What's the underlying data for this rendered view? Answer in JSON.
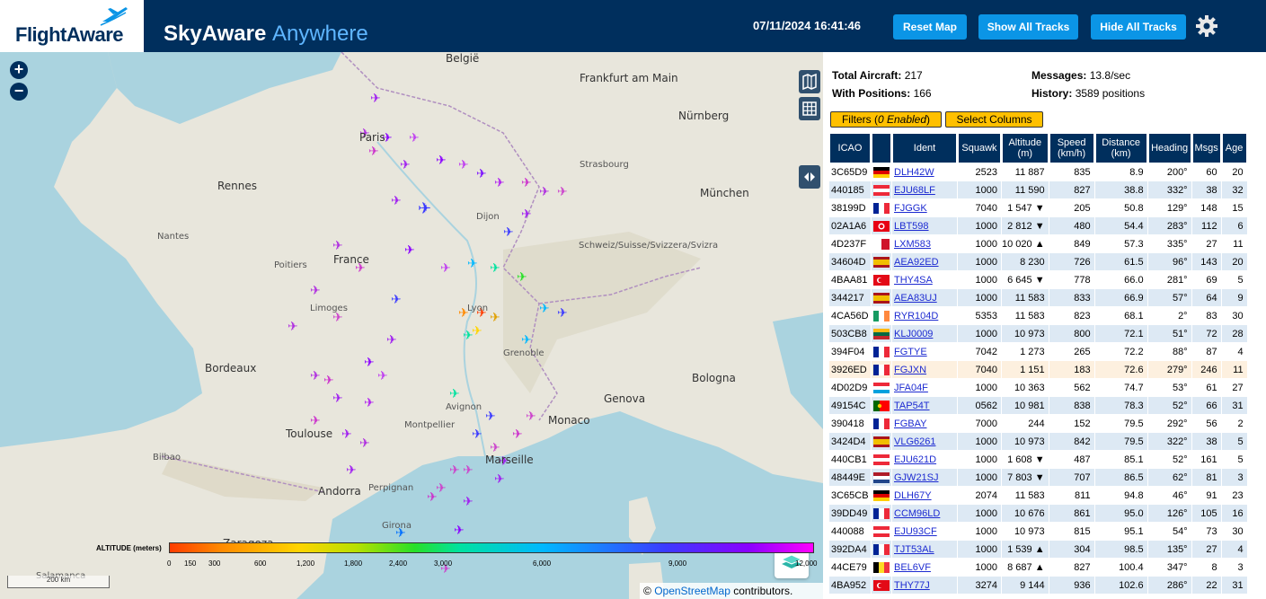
{
  "header": {
    "logo": "FlightAware",
    "brand_main": "SkyAware",
    "brand_accent": "Anywhere",
    "datetime": "07/11/2024 16:41:46",
    "reset_map": "Reset Map",
    "show_all_tracks": "Show All Tracks",
    "hide_all_tracks": "Hide All Tracks"
  },
  "map": {
    "zoom_in": "+",
    "zoom_out": "−",
    "labels": {
      "belgien": "België",
      "frankfurt": "Frankfurt am Main",
      "nurnberg": "Nürnberg",
      "paris": "Paris",
      "rennes": "Rennes",
      "france": "France",
      "bordeaux": "Bordeaux",
      "toulouse": "Toulouse",
      "andorra": "Andorra",
      "zaragoza": "Zaragoza",
      "munchen": "München",
      "genova": "Genova",
      "bologna": "Bologna",
      "marseille": "Marseille",
      "monaco": "Monaco",
      "grenoble": "Grenoble",
      "schweiz": "Schweiz/Suisse/Svizzera/Svizra",
      "strasbourg": "Strasbourg",
      "dijon": "Dijon",
      "lyon": "Lyon",
      "montpellier": "Montpellier",
      "poitiers": "Poitiers",
      "limoges": "Limoges",
      "nantes": "Nantes",
      "bilbao": "Bilbao",
      "perpignan": "Perpignan",
      "salamanca": "Salamanca",
      "avignon": "Avignon",
      "girona": "Girona"
    },
    "legend_title": "ALTITUDE (meters)",
    "legend_ticks": [
      "0",
      "150",
      "300",
      "600",
      "1,200",
      "1,800",
      "2,400",
      "3,000",
      "6,000",
      "9,000",
      "12,000"
    ],
    "scale": "200 km",
    "copyright_prefix": "©",
    "copyright_link": "OpenStreetMap",
    "copyright_suffix": "contributors."
  },
  "stats": {
    "total_label": "Total Aircraft:",
    "total_value": "217",
    "positions_label": "With Positions:",
    "positions_value": "166",
    "messages_label": "Messages:",
    "messages_value": "13.8/sec",
    "history_label": "History:",
    "history_value": "3589 positions"
  },
  "filters": {
    "filters_prefix": "Filters (",
    "filters_enabled": "0 Enabled",
    "filters_suffix": ")",
    "select_columns": "Select Columns"
  },
  "table": {
    "headers": [
      "ICAO",
      "",
      "Ident",
      "Squawk",
      "Altitude (m)",
      "Speed (km/h)",
      "Distance (km)",
      "Heading",
      "Msgs",
      "Age"
    ],
    "rows": [
      {
        "icao": "3C65D9",
        "flag": "de",
        "ident": "DLH42W",
        "squawk": "2523",
        "alt": "11 887",
        "speed": "835",
        "dist": "8.9",
        "heading": "200°",
        "msgs": "60",
        "age": "20"
      },
      {
        "icao": "440185",
        "flag": "at",
        "ident": "EJU68LF",
        "squawk": "1000",
        "alt": "11 590",
        "speed": "827",
        "dist": "38.8",
        "heading": "332°",
        "msgs": "38",
        "age": "32"
      },
      {
        "icao": "38199D",
        "flag": "fr",
        "ident": "FJGGK",
        "squawk": "7040",
        "alt": "1 547 ▼",
        "speed": "205",
        "dist": "50.8",
        "heading": "129°",
        "msgs": "148",
        "age": "15"
      },
      {
        "icao": "02A1A6",
        "flag": "tn",
        "ident": "LBT598",
        "squawk": "1000",
        "alt": "2 812 ▼",
        "speed": "480",
        "dist": "54.4",
        "heading": "283°",
        "msgs": "112",
        "age": "6"
      },
      {
        "icao": "4D237F",
        "flag": "mt",
        "ident": "LXM583",
        "squawk": "1000",
        "alt": "10 020 ▲",
        "speed": "849",
        "dist": "57.3",
        "heading": "335°",
        "msgs": "27",
        "age": "11"
      },
      {
        "icao": "34604D",
        "flag": "es",
        "ident": "AEA92ED",
        "squawk": "1000",
        "alt": "8 230",
        "speed": "726",
        "dist": "61.5",
        "heading": "96°",
        "msgs": "143",
        "age": "20"
      },
      {
        "icao": "4BAA81",
        "flag": "tr",
        "ident": "THY4SA",
        "squawk": "1000",
        "alt": "6 645 ▼",
        "speed": "778",
        "dist": "66.0",
        "heading": "281°",
        "msgs": "69",
        "age": "5"
      },
      {
        "icao": "344217",
        "flag": "es",
        "ident": "AEA83UJ",
        "squawk": "1000",
        "alt": "11 583",
        "speed": "833",
        "dist": "66.9",
        "heading": "57°",
        "msgs": "64",
        "age": "9"
      },
      {
        "icao": "4CA56D",
        "flag": "ie",
        "ident": "RYR104D",
        "squawk": "5353",
        "alt": "11 583",
        "speed": "823",
        "dist": "68.1",
        "heading": "2°",
        "msgs": "83",
        "age": "30"
      },
      {
        "icao": "503CB8",
        "flag": "lt",
        "ident": "KLJ0009",
        "squawk": "1000",
        "alt": "10 973",
        "speed": "800",
        "dist": "72.1",
        "heading": "51°",
        "msgs": "72",
        "age": "28"
      },
      {
        "icao": "394F04",
        "flag": "fr",
        "ident": "FGTYE",
        "squawk": "7042",
        "alt": "1 273",
        "speed": "265",
        "dist": "72.2",
        "heading": "88°",
        "msgs": "87",
        "age": "4"
      },
      {
        "icao": "3926ED",
        "flag": "fr",
        "ident": "FGJXN",
        "squawk": "7040",
        "alt": "1 151",
        "speed": "183",
        "dist": "72.6",
        "heading": "279°",
        "msgs": "246",
        "age": "11"
      },
      {
        "icao": "4D02D9",
        "flag": "lu",
        "ident": "JFA04F",
        "squawk": "1000",
        "alt": "10 363",
        "speed": "562",
        "dist": "74.7",
        "heading": "53°",
        "msgs": "61",
        "age": "27"
      },
      {
        "icao": "49154C",
        "flag": "pt",
        "ident": "TAP54T",
        "squawk": "0562",
        "alt": "10 981",
        "speed": "838",
        "dist": "78.3",
        "heading": "52°",
        "msgs": "66",
        "age": "31"
      },
      {
        "icao": "390418",
        "flag": "fr",
        "ident": "FGBAY",
        "squawk": "7000",
        "alt": "244",
        "speed": "152",
        "dist": "79.5",
        "heading": "292°",
        "msgs": "56",
        "age": "2"
      },
      {
        "icao": "3424D4",
        "flag": "es",
        "ident": "VLG6261",
        "squawk": "1000",
        "alt": "10 973",
        "speed": "842",
        "dist": "79.5",
        "heading": "322°",
        "msgs": "38",
        "age": "5"
      },
      {
        "icao": "440CB1",
        "flag": "at",
        "ident": "EJU621D",
        "squawk": "1000",
        "alt": "1 608 ▼",
        "speed": "487",
        "dist": "85.1",
        "heading": "52°",
        "msgs": "161",
        "age": "5"
      },
      {
        "icao": "48449E",
        "flag": "nl",
        "ident": "GJW21SJ",
        "squawk": "1000",
        "alt": "7 803 ▼",
        "speed": "707",
        "dist": "86.5",
        "heading": "62°",
        "msgs": "81",
        "age": "3"
      },
      {
        "icao": "3C65CB",
        "flag": "de",
        "ident": "DLH67Y",
        "squawk": "2074",
        "alt": "11 583",
        "speed": "811",
        "dist": "94.8",
        "heading": "46°",
        "msgs": "91",
        "age": "23"
      },
      {
        "icao": "39DD49",
        "flag": "fr",
        "ident": "CCM96LD",
        "squawk": "1000",
        "alt": "10 676",
        "speed": "861",
        "dist": "95.0",
        "heading": "126°",
        "msgs": "105",
        "age": "16"
      },
      {
        "icao": "440088",
        "flag": "at",
        "ident": "EJU93CF",
        "squawk": "1000",
        "alt": "10 973",
        "speed": "815",
        "dist": "95.1",
        "heading": "54°",
        "msgs": "73",
        "age": "30"
      },
      {
        "icao": "392DA4",
        "flag": "fr",
        "ident": "TJT53AL",
        "squawk": "1000",
        "alt": "1 539 ▲",
        "speed": "304",
        "dist": "98.5",
        "heading": "135°",
        "msgs": "27",
        "age": "4"
      },
      {
        "icao": "44CE79",
        "flag": "be",
        "ident": "BEL6VF",
        "squawk": "1000",
        "alt": "8 687 ▲",
        "speed": "827",
        "dist": "100.4",
        "heading": "347°",
        "msgs": "8",
        "age": "3"
      },
      {
        "icao": "4BA952",
        "flag": "tr",
        "ident": "THY77J",
        "squawk": "3274",
        "alt": "9 144",
        "speed": "936",
        "dist": "102.6",
        "heading": "286°",
        "msgs": "22",
        "age": "31"
      }
    ]
  },
  "colors": {
    "header_bg": "#002f5d",
    "button": "#0b95e6",
    "yellow_button": "#ffc000",
    "row_alt": "#dde9f4",
    "selected_row": "#fdf0df",
    "ident_link": "#1d2bd1"
  }
}
